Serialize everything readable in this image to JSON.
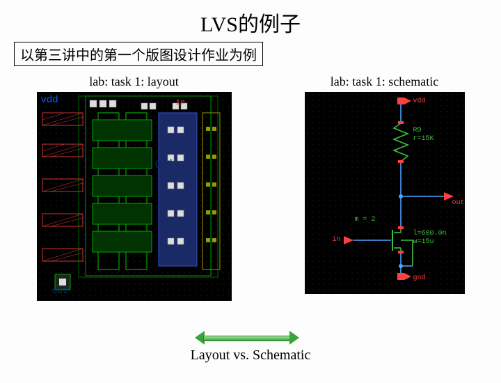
{
  "title": "LVS的例子",
  "subtitle": "以第三讲中的第一个版图设计作业为例",
  "left": {
    "label": "lab: task 1: layout",
    "vdd": "vdd",
    "in": "in",
    "gnd": "gnd",
    "out": "out"
  },
  "right": {
    "label": "lab: task 1: schematic",
    "vdd": "vdd",
    "r_name": "R0",
    "r_value": "r=15K",
    "out": "out",
    "m_mult": "m = 2",
    "in": "in",
    "t_l": "l=600.0n",
    "t_w": "w=15u",
    "gnd": "gnd"
  },
  "footer": "Layout vs. Schematic"
}
